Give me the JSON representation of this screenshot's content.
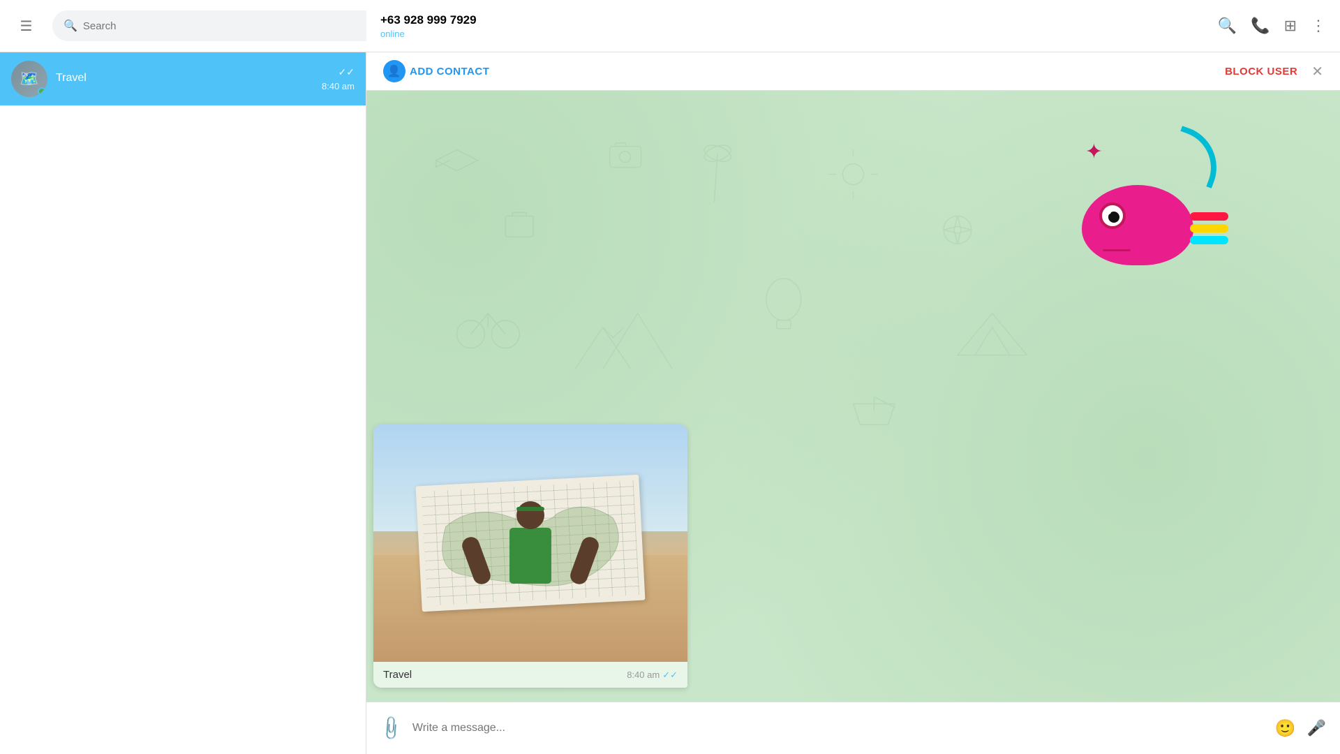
{
  "window": {
    "minimize": "−",
    "restore": "⧉",
    "close": "✕"
  },
  "topbar": {
    "search_placeholder": "Search"
  },
  "chat_header": {
    "phone": "+63 928 999 7929",
    "status": "online"
  },
  "action_bar": {
    "add_contact": "ADD CONTACT",
    "block_user": "BLOCK USER",
    "close": "✕"
  },
  "chat_list": {
    "item": {
      "name": "Travel",
      "time": "8:40 am"
    }
  },
  "message": {
    "caption": "Travel",
    "time": "8:40 am"
  },
  "compose": {
    "placeholder": "Write a message..."
  }
}
